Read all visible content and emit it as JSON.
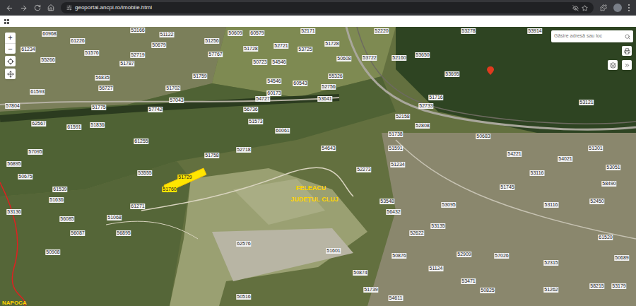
{
  "browser": {
    "url": "geoportal.ancpi.ro/imobile.html"
  },
  "search": {
    "placeholder": "Găsire adresă sau loc"
  },
  "zoom": {
    "in": "+",
    "out": "−"
  },
  "map": {
    "places": [
      {
        "text": "FELEACU"
      },
      {
        "text": "JUDEȚUL CLUJ"
      },
      {
        "text": "NAPOCA"
      }
    ],
    "selected_parcel": {
      "labels": [
        "51729",
        "51760"
      ]
    },
    "parcels": [
      "60968",
      "61226",
      "53166",
      "51122",
      "50609",
      "60579",
      "51256",
      "52171",
      "52220",
      "53278",
      "53914",
      "61234",
      "55266",
      "51576",
      "52719",
      "51787",
      "50679",
      "57767",
      "51728",
      "50723",
      "54546",
      "52721",
      "53725",
      "51728",
      "50608",
      "53722",
      "52160",
      "53650",
      "53695",
      "52733",
      "52158",
      "51716",
      "52808",
      "54546",
      "60173",
      "55326",
      "60543",
      "53641",
      "54727",
      "56736",
      "51573",
      "51759",
      "51702",
      "57043",
      "51775",
      "56727",
      "57742",
      "61591",
      "62567",
      "57095",
      "56895",
      "61539",
      "51636",
      "56085",
      "50908",
      "56087",
      "51068",
      "61271",
      "53555",
      "51758",
      "52718",
      "60061",
      "54643",
      "51591",
      "53548",
      "52273",
      "51234",
      "56432",
      "51738",
      "53121",
      "51301",
      "58490",
      "53051",
      "52450",
      "53116",
      "52909",
      "50876",
      "57026",
      "51124",
      "50825",
      "54611",
      "50874",
      "51739",
      "52622",
      "53135",
      "53095",
      "52315",
      "61520",
      "53179",
      "51262",
      "58215",
      "53471",
      "50689",
      "54021",
      "53116",
      "50683",
      "54221",
      "51745",
      "52756",
      "56835",
      "61593",
      "57804",
      "51836",
      "61255",
      "50675",
      "53136",
      "62576",
      "50516",
      "51601",
      "56895"
    ]
  }
}
